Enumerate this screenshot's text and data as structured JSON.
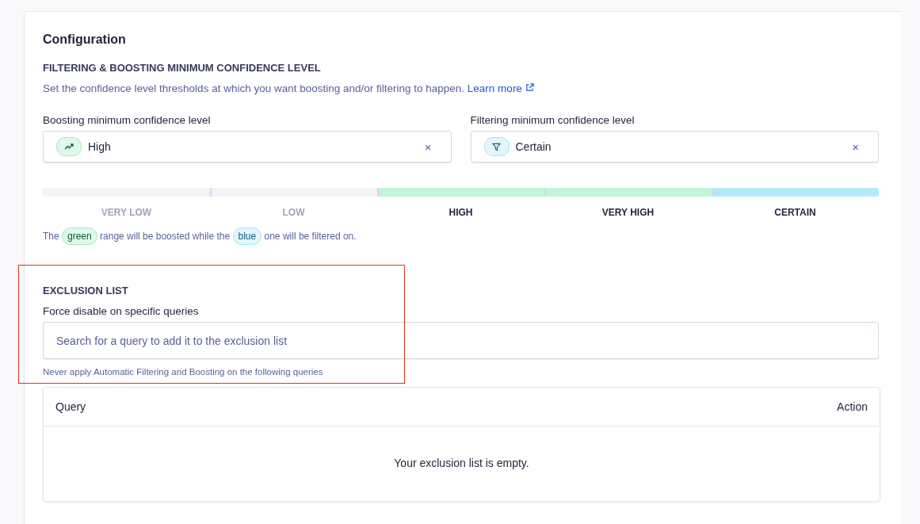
{
  "card": {
    "title": "Configuration"
  },
  "confidence": {
    "heading": "FILTERING & BOOSTING MINIMUM CONFIDENCE LEVEL",
    "description": "Set the confidence level thresholds at which you want boosting and/or filtering to happen.",
    "link": "Learn more",
    "selects": [
      {
        "label": "Boosting minimum confidence level",
        "value": "High",
        "kind": "boost",
        "clear": "×"
      },
      {
        "label": "Filtering minimum confidence level",
        "value": "Certain",
        "kind": "filter",
        "clear": "×"
      }
    ],
    "levels": [
      {
        "label": "VERY LOW",
        "color": "#f3f3f8",
        "active": false
      },
      {
        "label": "LOW",
        "color": "#f3f3f8",
        "active": false
      },
      {
        "label": "HIGH",
        "color": "#c2f4d9",
        "active": true
      },
      {
        "label": "VERY HIGH",
        "color": "#c2f4d9",
        "active": true
      },
      {
        "label": "CERTAIN",
        "color": "#b4e9fc",
        "active": true
      }
    ],
    "legend": [
      {
        "text": "The ",
        "kind": "plain"
      },
      {
        "text": "green",
        "kind": "boost"
      },
      {
        "text": " range will be boosted while the ",
        "kind": "plain"
      },
      {
        "text": "blue",
        "kind": "filter"
      },
      {
        "text": " one will be filtered on.",
        "kind": "plain"
      }
    ]
  },
  "exclusion": {
    "heading": "EXCLUSION LIST",
    "label": "Force disable on specific queries",
    "search": {
      "placeholder": "Search for a query to add it to the exclusion list"
    },
    "hint": "Never apply Automatic Filtering and Boosting on the following queries",
    "highlighted": true,
    "table": {
      "columns": [
        "Query",
        "Action"
      ],
      "empty": "Your exclusion list is empty."
    }
  }
}
